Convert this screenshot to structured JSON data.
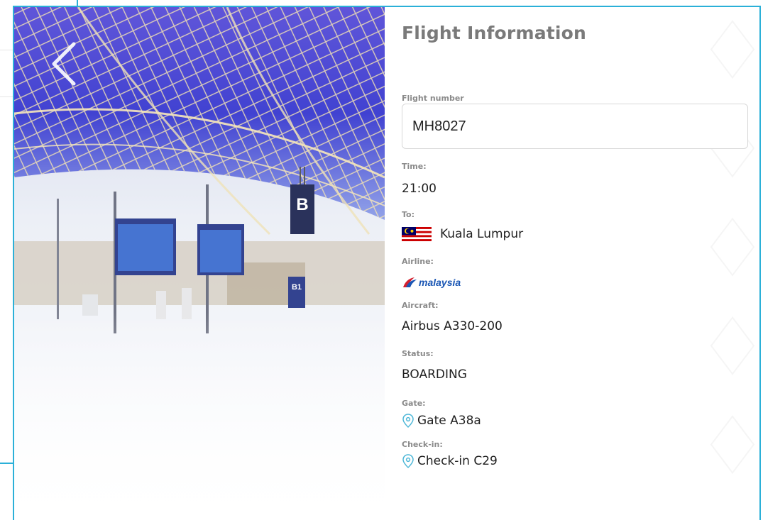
{
  "panel": {
    "title": "Flight Information"
  },
  "fields": {
    "flight_number_label": "Flight number",
    "flight_number_value": "MH8027",
    "time_label": "Time:",
    "time_value": "21:00",
    "to_label": "To:",
    "to_value": "Kuala Lumpur",
    "airline_label": "Airline:",
    "airline_logo_text": "malaysia",
    "aircraft_label": "Aircraft:",
    "aircraft_value": "Airbus A330-200",
    "status_label": "Status:",
    "status_value": "BOARDING",
    "gate_label": "Gate:",
    "gate_value": "Gate A38a",
    "checkin_label": "Check-in:",
    "checkin_value": "Check-in C29"
  },
  "photo": {
    "sign_letter": "B",
    "sign_small": "B1"
  },
  "icons": {
    "back": "chevron-left-icon",
    "flag": "malaysia-flag-icon",
    "pin": "location-pin-icon",
    "airline": "malaysia-airlines-logo-icon"
  },
  "colors": {
    "accent": "#2bb0d8",
    "title": "#7a7a7a",
    "label": "#8a8a8a",
    "pin": "#4fb8d8",
    "airline_blue": "#1a56b4",
    "airline_red": "#d3202f"
  }
}
